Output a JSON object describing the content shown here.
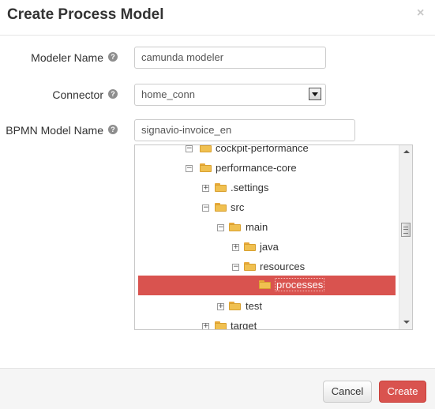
{
  "dialog": {
    "title": "Create Process Model",
    "close_symbol": "×"
  },
  "form": {
    "modeler_name": {
      "label": "Modeler Name",
      "help": "?",
      "value": "camunda modeler"
    },
    "connector": {
      "label": "Connector",
      "help": "?",
      "value": "home_conn"
    },
    "bpmn_model_name": {
      "label": "BPMN Model Name",
      "help": "?",
      "value": "signavio-invoice_en"
    }
  },
  "tree": {
    "items": [
      {
        "label": "cockpit-performance",
        "toggle": "−",
        "state": "expanded"
      },
      {
        "label": "performance-core",
        "toggle": "−",
        "state": "expanded"
      },
      {
        "label": ".settings",
        "toggle": "+",
        "state": "collapsed"
      },
      {
        "label": "src",
        "toggle": "−",
        "state": "expanded"
      },
      {
        "label": "main",
        "toggle": "−",
        "state": "expanded"
      },
      {
        "label": "java",
        "toggle": "+",
        "state": "collapsed"
      },
      {
        "label": "resources",
        "toggle": "−",
        "state": "expanded"
      },
      {
        "label": "processes",
        "toggle": "",
        "state": "selected"
      },
      {
        "label": "test",
        "toggle": "+",
        "state": "collapsed"
      },
      {
        "label": "target",
        "toggle": "+",
        "state": "collapsed"
      }
    ]
  },
  "footer": {
    "cancel_label": "Cancel",
    "create_label": "Create"
  },
  "colors": {
    "primary": "#d9534f",
    "folder": "#f0c050"
  }
}
